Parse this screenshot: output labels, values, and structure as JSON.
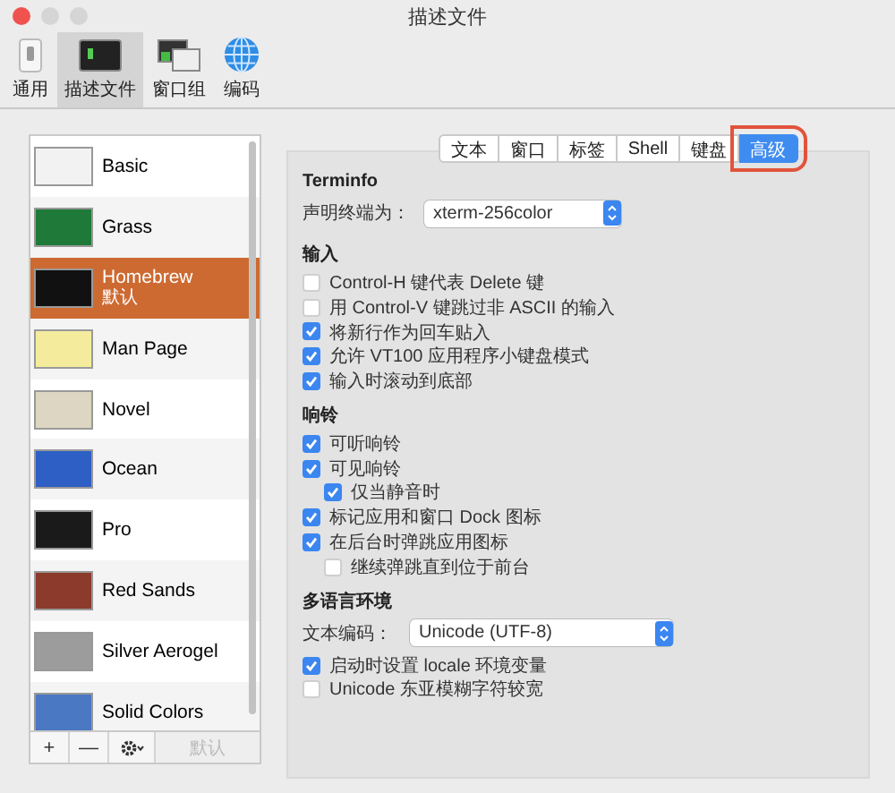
{
  "window": {
    "title": "描述文件"
  },
  "toolbar": [
    {
      "label": "通用",
      "kind": "general",
      "selected": false
    },
    {
      "label": "描述文件",
      "kind": "profiles",
      "selected": true
    },
    {
      "label": "窗口组",
      "kind": "groups",
      "selected": false
    },
    {
      "label": "编码",
      "kind": "encoding",
      "selected": false
    }
  ],
  "profiles": [
    {
      "name": "Basic",
      "color": "#f2f2f2",
      "selected": false
    },
    {
      "name": "Grass",
      "color": "#1f7a3a",
      "selected": false
    },
    {
      "name": "Homebrew",
      "subtitle": "默认",
      "color": "#111111",
      "selected": true
    },
    {
      "name": "Man Page",
      "color": "#f4ec9c",
      "selected": false
    },
    {
      "name": "Novel",
      "color": "#dcd6c2",
      "selected": false
    },
    {
      "name": "Ocean",
      "color": "#2d5fc4",
      "selected": false
    },
    {
      "name": "Pro",
      "color": "#1a1a1a",
      "selected": false
    },
    {
      "name": "Red Sands",
      "color": "#8c3a2b",
      "selected": false
    },
    {
      "name": "Silver Aerogel",
      "color": "#9c9c9c",
      "selected": false
    },
    {
      "name": "Solid Colors",
      "color": "#4a78c2",
      "selected": false
    }
  ],
  "list_buttons": [
    {
      "label": "+",
      "disabled": false
    },
    {
      "label": "—",
      "disabled": false
    },
    {
      "label": "默认",
      "disabled": true
    }
  ],
  "tabs": [
    {
      "label": "文本",
      "selected": false
    },
    {
      "label": "窗口",
      "selected": false
    },
    {
      "label": "标签",
      "selected": false
    },
    {
      "label": "Shell",
      "selected": false
    },
    {
      "label": "键盘",
      "selected": false
    },
    {
      "label": "高级",
      "selected": true
    }
  ],
  "sections": [
    {
      "title": "Terminfo",
      "items": [
        {
          "kind": "select",
          "label": "声明终端为：",
          "value": "xterm-256color"
        }
      ]
    },
    {
      "title": "输入",
      "items": [
        {
          "kind": "checkbox",
          "label": "Control-H 键代表 Delete 键",
          "checked": false
        },
        {
          "kind": "checkbox",
          "label": "用 Control-V 键跳过非 ASCII 的输入",
          "checked": false
        },
        {
          "kind": "checkbox",
          "label": "将新行作为回车贴入",
          "checked": true
        },
        {
          "kind": "checkbox",
          "label": "允许 VT100 应用程序小键盘模式",
          "checked": true
        },
        {
          "kind": "checkbox",
          "label": "输入时滚动到底部",
          "checked": true
        }
      ]
    },
    {
      "title": "响铃",
      "items": [
        {
          "kind": "checkbox",
          "label": "可听响铃",
          "checked": true
        },
        {
          "kind": "checkbox",
          "label": "可见响铃",
          "checked": true,
          "children": [
            {
              "kind": "checkbox",
              "label": "仅当静音时",
              "checked": true
            }
          ]
        },
        {
          "kind": "checkbox",
          "label": "标记应用和窗口 Dock 图标",
          "checked": true
        },
        {
          "kind": "checkbox",
          "label": "在后台时弹跳应用图标",
          "checked": true,
          "children": [
            {
              "kind": "checkbox",
              "label": "继续弹跳直到位于前台",
              "checked": false
            }
          ]
        }
      ]
    },
    {
      "title": "多语言环境",
      "items": [
        {
          "kind": "select",
          "label": "文本编码：",
          "value": "Unicode (UTF-8)"
        },
        {
          "kind": "checkbox",
          "label": "启动时设置 locale 环境变量",
          "checked": true
        },
        {
          "kind": "checkbox",
          "label": "Unicode 东亚模糊字符较宽",
          "checked": false
        }
      ]
    }
  ]
}
